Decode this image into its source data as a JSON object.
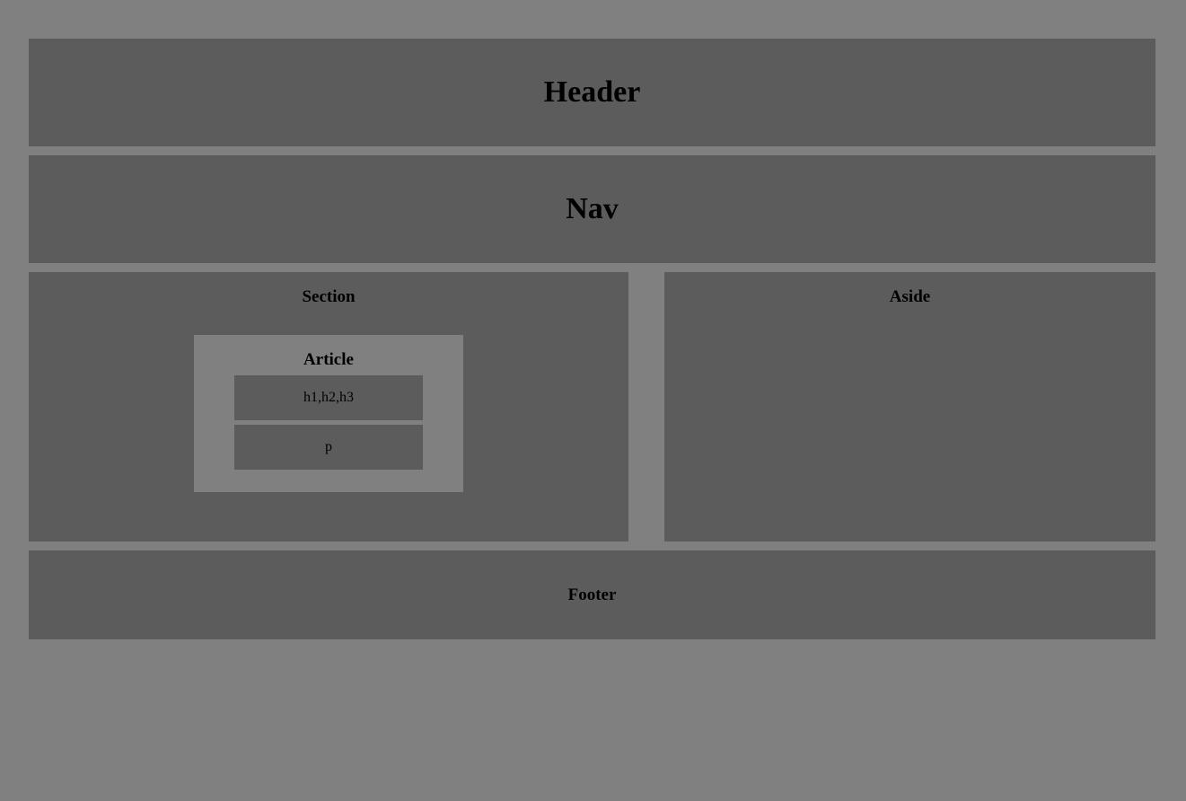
{
  "header": {
    "label": "Header"
  },
  "nav": {
    "label": "Nav"
  },
  "section": {
    "label": "Section",
    "article": {
      "label": "Article",
      "headings_label": "h1,h2,h3",
      "paragraph_label": "p"
    }
  },
  "aside": {
    "label": "Aside"
  },
  "footer": {
    "label": "Footer"
  },
  "colors": {
    "page_background": "#808080",
    "block_fill": "#5c5c5c",
    "text": "#000000"
  }
}
